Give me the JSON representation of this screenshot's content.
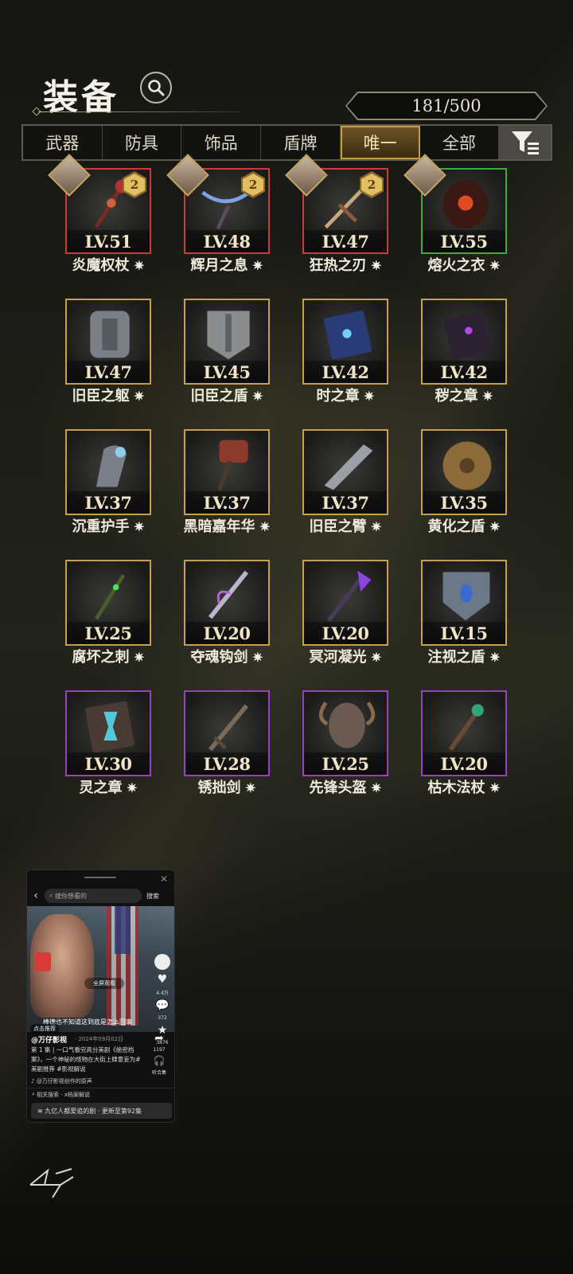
{
  "header": {
    "title": "装备",
    "count": "181/500"
  },
  "tabs": [
    {
      "label": "武器",
      "active": false
    },
    {
      "label": "防具",
      "active": false
    },
    {
      "label": "饰品",
      "active": false
    },
    {
      "label": "盾牌",
      "active": false
    },
    {
      "label": "唯一",
      "active": true
    },
    {
      "label": "全部",
      "active": false
    }
  ],
  "items": [
    {
      "level": "LV.51",
      "name": "炎魔权杖",
      "rarity": "red",
      "badge": "2",
      "has_avatar": true
    },
    {
      "level": "LV.48",
      "name": "辉月之息",
      "rarity": "red",
      "badge": "2",
      "has_avatar": true
    },
    {
      "level": "LV.47",
      "name": "狂热之刃",
      "rarity": "red",
      "badge": "2",
      "has_avatar": true
    },
    {
      "level": "LV.55",
      "name": "熔火之衣",
      "rarity": "green",
      "badge": "",
      "has_avatar": true
    },
    {
      "level": "LV.47",
      "name": "旧臣之躯",
      "rarity": "gold",
      "badge": "",
      "has_avatar": false
    },
    {
      "level": "LV.45",
      "name": "旧臣之盾",
      "rarity": "gold",
      "badge": "",
      "has_avatar": false
    },
    {
      "level": "LV.42",
      "name": "时之章",
      "rarity": "gold",
      "badge": "",
      "has_avatar": false
    },
    {
      "level": "LV.42",
      "name": "秽之章",
      "rarity": "gold",
      "badge": "",
      "has_avatar": false
    },
    {
      "level": "LV.37",
      "name": "沉重护手",
      "rarity": "gold",
      "badge": "",
      "has_avatar": false
    },
    {
      "level": "LV.37",
      "name": "黑暗嘉年华",
      "rarity": "gold",
      "badge": "",
      "has_avatar": false
    },
    {
      "level": "LV.37",
      "name": "旧臣之臂",
      "rarity": "gold",
      "badge": "",
      "has_avatar": false
    },
    {
      "level": "LV.35",
      "name": "黄化之盾",
      "rarity": "gold",
      "badge": "",
      "has_avatar": false
    },
    {
      "level": "LV.25",
      "name": "腐坏之刺",
      "rarity": "gold",
      "badge": "",
      "has_avatar": false
    },
    {
      "level": "LV.20",
      "name": "夺魂钩剑",
      "rarity": "gold",
      "badge": "",
      "has_avatar": false
    },
    {
      "level": "LV.20",
      "name": "冥河凝光",
      "rarity": "gold",
      "badge": "",
      "has_avatar": false
    },
    {
      "level": "LV.15",
      "name": "注视之盾",
      "rarity": "gold",
      "badge": "",
      "has_avatar": false
    },
    {
      "level": "LV.30",
      "name": "灵之章",
      "rarity": "purple",
      "badge": "",
      "has_avatar": false
    },
    {
      "level": "LV.28",
      "name": "锈拙剑",
      "rarity": "purple",
      "badge": "",
      "has_avatar": false
    },
    {
      "level": "LV.25",
      "name": "先锋头盔",
      "rarity": "purple",
      "badge": "",
      "has_avatar": false
    },
    {
      "level": "LV.20",
      "name": "枯木法杖",
      "rarity": "purple",
      "badge": "",
      "has_avatar": false
    }
  ],
  "mini_player": {
    "search_placeholder": "搜你想看的",
    "search_button": "搜索",
    "fullscreen": "全屏观看",
    "subtitle": "棒德也不知道这到底是怎么回事",
    "recommend": "点击推荐",
    "side": [
      {
        "icon": "heart-icon",
        "count": "4.4万"
      },
      {
        "icon": "comment-icon",
        "count": "372"
      },
      {
        "icon": "star-icon",
        "count": "3876"
      },
      {
        "icon": "share-icon",
        "count": "1197"
      },
      {
        "icon": "headphones-icon",
        "count": "听合集"
      }
    ],
    "author": "@万仔影视",
    "date": "· 2024年09月02日",
    "description": "第 1 集 | 一口气看完高分美剧《绝密档案》，一个神秘的怪物在大街上肆意妄为#美剧推荐 #影视解说",
    "music": "@万仔影视创作的原声",
    "related": "相关搜索 · x档案解说",
    "episode_bar": "九亿人都爱追的剧 · 更新至第92集"
  },
  "colors": {
    "rarity_red": "#d0383a",
    "rarity_gold": "#c9a04a",
    "rarity_green": "#3cad3c",
    "rarity_purple": "#9a3fc0",
    "tab_active": "#c39c4a"
  }
}
